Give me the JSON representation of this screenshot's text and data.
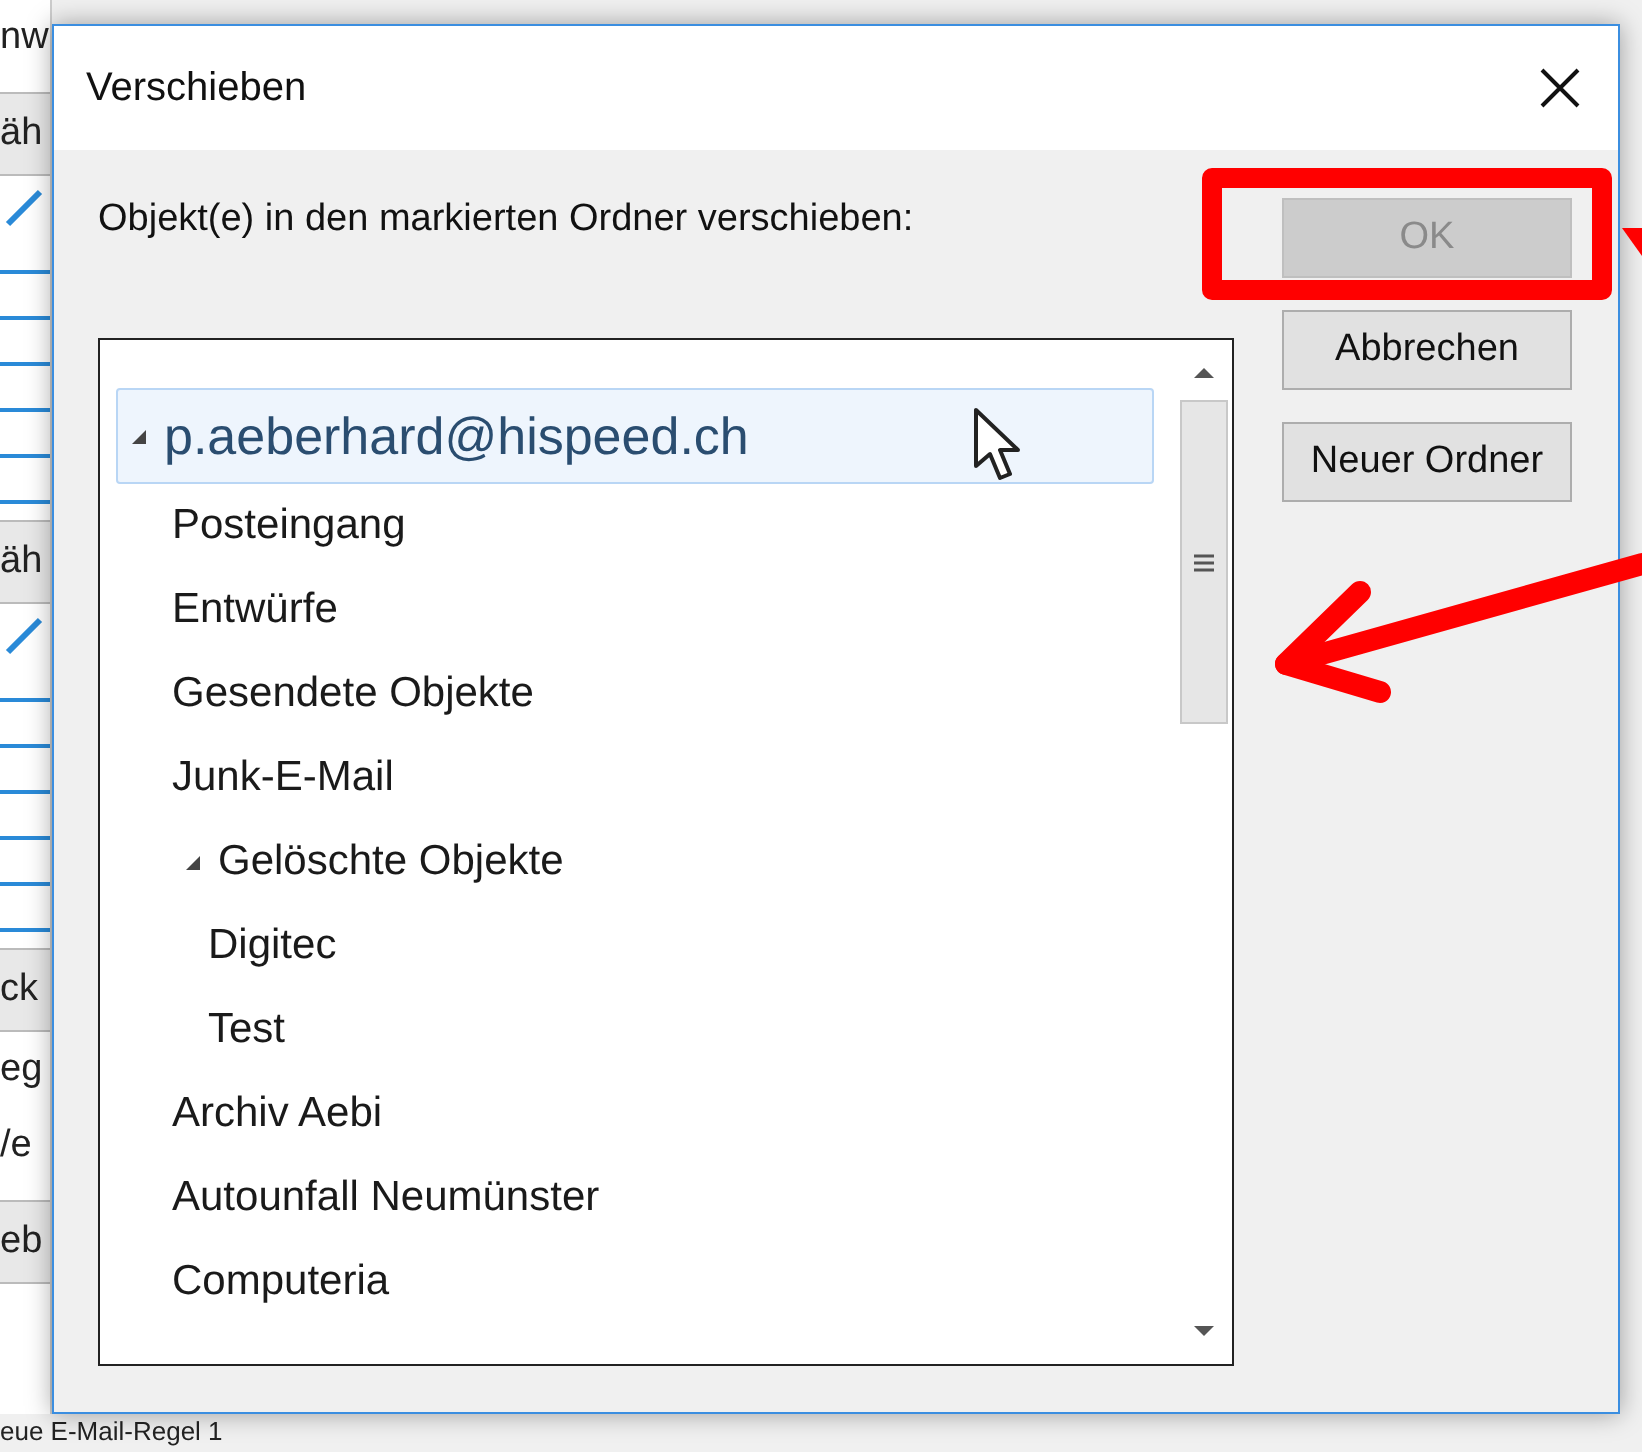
{
  "background_window": {
    "fragments": [
      {
        "text": "nw",
        "kind": "label"
      },
      {
        "text": "äh",
        "kind": "header"
      },
      {
        "kind": "rows"
      },
      {
        "text": "äh",
        "kind": "header"
      },
      {
        "kind": "rows"
      },
      {
        "text": "ck",
        "kind": "header"
      },
      {
        "text": "eg",
        "kind": "label"
      },
      {
        "text": "/e",
        "kind": "label"
      },
      {
        "text": "eb",
        "kind": "header"
      }
    ],
    "status_text": "eue E-Mail-Regel 1"
  },
  "dialog": {
    "title": "Verschieben",
    "prompt": "Objekt(e) in den markierten Ordner verschieben:",
    "folders": [
      {
        "label": "p.aeberhard@hispeed.ch",
        "expanded": true,
        "selected": true,
        "children": [
          {
            "label": "Posteingang",
            "expanded": false,
            "selected": false
          },
          {
            "label": "Entwürfe",
            "expanded": false,
            "selected": false
          },
          {
            "label": "Gesendete Objekte",
            "expanded": false,
            "selected": false
          },
          {
            "label": "Junk-E-Mail",
            "expanded": false,
            "selected": false
          },
          {
            "label": "Gelöschte Objekte",
            "expanded": true,
            "selected": false,
            "children": [
              {
                "label": "Digitec",
                "expanded": false,
                "selected": false
              },
              {
                "label": "Test",
                "expanded": false,
                "selected": false
              }
            ]
          },
          {
            "label": "Archiv Aebi",
            "expanded": false,
            "selected": false
          },
          {
            "label": "Autounfall Neumünster",
            "expanded": false,
            "selected": false
          },
          {
            "label": "Computeria",
            "expanded": false,
            "selected": false
          }
        ]
      }
    ],
    "buttons": [
      {
        "label": "OK",
        "disabled": true
      },
      {
        "label": "Abbrechen",
        "disabled": false
      },
      {
        "label": "Neuer Ordner",
        "disabled": false
      }
    ]
  },
  "annotations": [
    {
      "kind": "box"
    },
    {
      "kind": "arrow"
    },
    {
      "kind": "arrow-tip"
    }
  ]
}
